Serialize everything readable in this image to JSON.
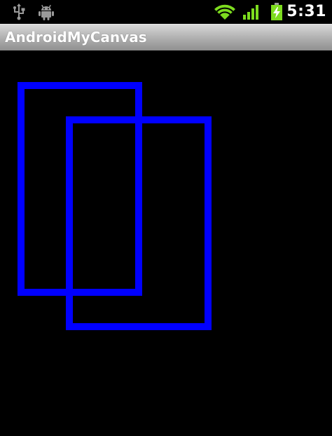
{
  "status_bar": {
    "time": "5:31",
    "icons": [
      "usb-icon",
      "android-debug-icon",
      "wifi-icon",
      "signal-icon",
      "battery-charging-icon"
    ]
  },
  "app": {
    "title": "AndroidMyCanvas"
  },
  "colors": {
    "background": "#000000",
    "stroke": "#0000ff",
    "wifi": "#7ddc1f",
    "signal": "#7ddc1f",
    "battery": "#7ddc1f",
    "status_icons": "#9a9a9a"
  }
}
